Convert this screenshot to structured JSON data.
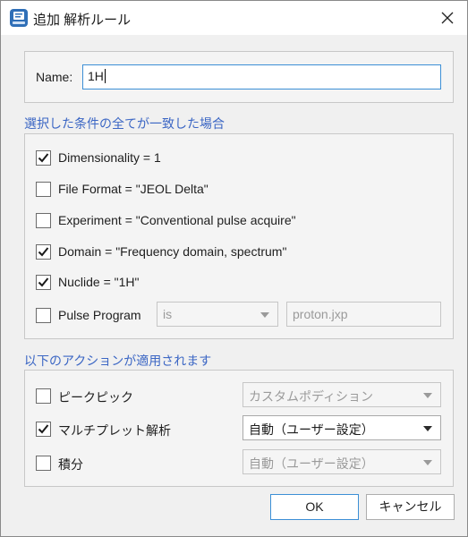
{
  "window": {
    "title": "追加 解析ルール",
    "app_icon": "document-app-icon",
    "close_icon": "close-icon"
  },
  "name_field": {
    "label": "Name:",
    "value": "1H"
  },
  "conditions": {
    "title": "選択した条件の全てが一致した場合",
    "items": [
      {
        "label": "Dimensionality = 1",
        "checked": true
      },
      {
        "label": "File Format = \"JEOL Delta\"",
        "checked": false
      },
      {
        "label": "Experiment = \"Conventional pulse acquire\"",
        "checked": false
      },
      {
        "label": "Domain = \"Frequency domain, spectrum\"",
        "checked": true
      },
      {
        "label": "Nuclide = \"1H\"",
        "checked": true
      },
      {
        "label": "Pulse Program",
        "checked": false
      }
    ],
    "pulse_program": {
      "operator": "is",
      "value": "proton.jxp"
    }
  },
  "actions": {
    "title": "以下のアクションが適用されます",
    "items": [
      {
        "label": "ピークピック",
        "checked": false,
        "option": "カスタムポディション",
        "enabled": false
      },
      {
        "label": "マルチプレット解析",
        "checked": true,
        "option": "自動（ユーザー設定）",
        "enabled": true
      },
      {
        "label": "積分",
        "checked": false,
        "option": "自動（ユーザー設定）",
        "enabled": false
      }
    ]
  },
  "buttons": {
    "ok": "OK",
    "cancel": "キャンセル"
  },
  "colors": {
    "accent": "#3c8fd6",
    "section_title": "#3b66c4",
    "disabled_text": "#9a9a9a"
  }
}
